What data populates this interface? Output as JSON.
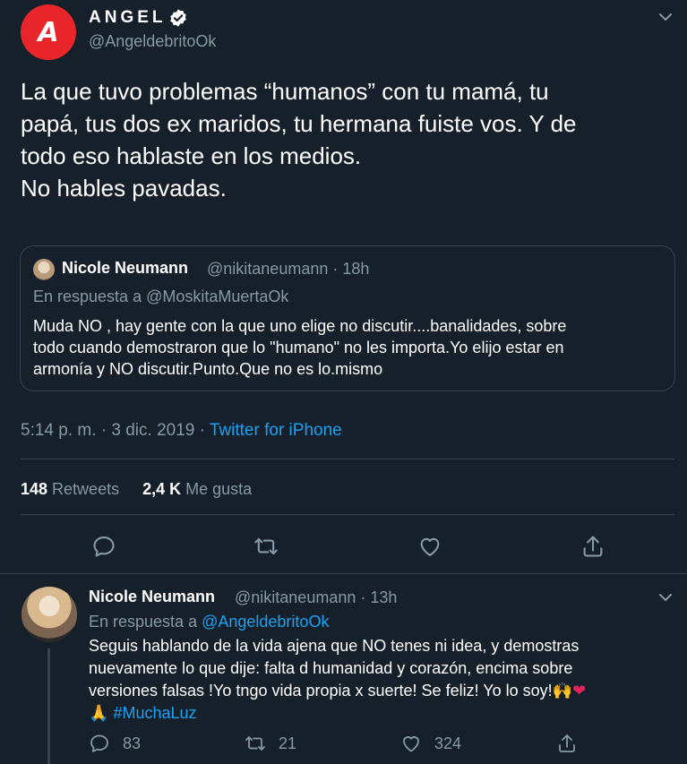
{
  "main_tweet": {
    "avatar_letter": "A",
    "display_name": "ANGEL",
    "handle": "@AngeldebritoOk",
    "text": "La que tuvo problemas “humanos” con tu mamá, tu\npapá, tus dos ex maridos, tu hermana fuiste vos. Y de\ntodo eso hablaste en los medios.\nNo hables pavadas.",
    "timestamp": "5:14 p. m. · 3 dic. 2019 · ",
    "source": "Twitter for iPhone",
    "retweets_count": "148",
    "retweets_label": "Retweets",
    "likes_count": "2,4 K",
    "likes_label": "Me gusta"
  },
  "quoted_tweet": {
    "name": "Nicole Neumann",
    "meta": "@nikitaneumann · 18h",
    "reply_to": "En respuesta a @MoskitaMuertaOk",
    "text": "Muda NO , hay gente con la que uno elige no discutir....banalidades, sobre\ntodo cuando demostraron que lo \"humano\" no les importa.Yo elijo estar en\narmonía y NO discutir.Punto.Que no es lo.mismo"
  },
  "reply_tweet": {
    "name": "Nicole Neumann",
    "meta": "@nikitaneumann · 13h",
    "reply_prefix": "En respuesta a ",
    "reply_mention": "@AngeldebritoOk",
    "text_line1": "Seguis hablando de la vida ajena que NO tenes ni idea, y demostras",
    "text_line2": "nuevamente lo que dije: falta d humanidad y corazón,  encima sobre",
    "text_line3": "versiones falsas !Yo tngo vida propia x suerte! Se feliz! Yo lo soy!",
    "emoji_hands": "🙌",
    "emoji_heart": "❤",
    "emoji_pray": "🙏",
    "hashtag": "#MuchaLuz",
    "reply_count": "83",
    "retweet_count": "21",
    "like_count": "324"
  },
  "colors": {
    "background": "#15202b",
    "accent": "#1da1f2",
    "muted": "#8899a6",
    "divider": "#38444d",
    "brand_red": "#e8262a"
  },
  "icons": [
    "verified-badge-icon",
    "chevron-down-icon",
    "reply-icon",
    "retweet-icon",
    "like-icon",
    "share-icon"
  ]
}
